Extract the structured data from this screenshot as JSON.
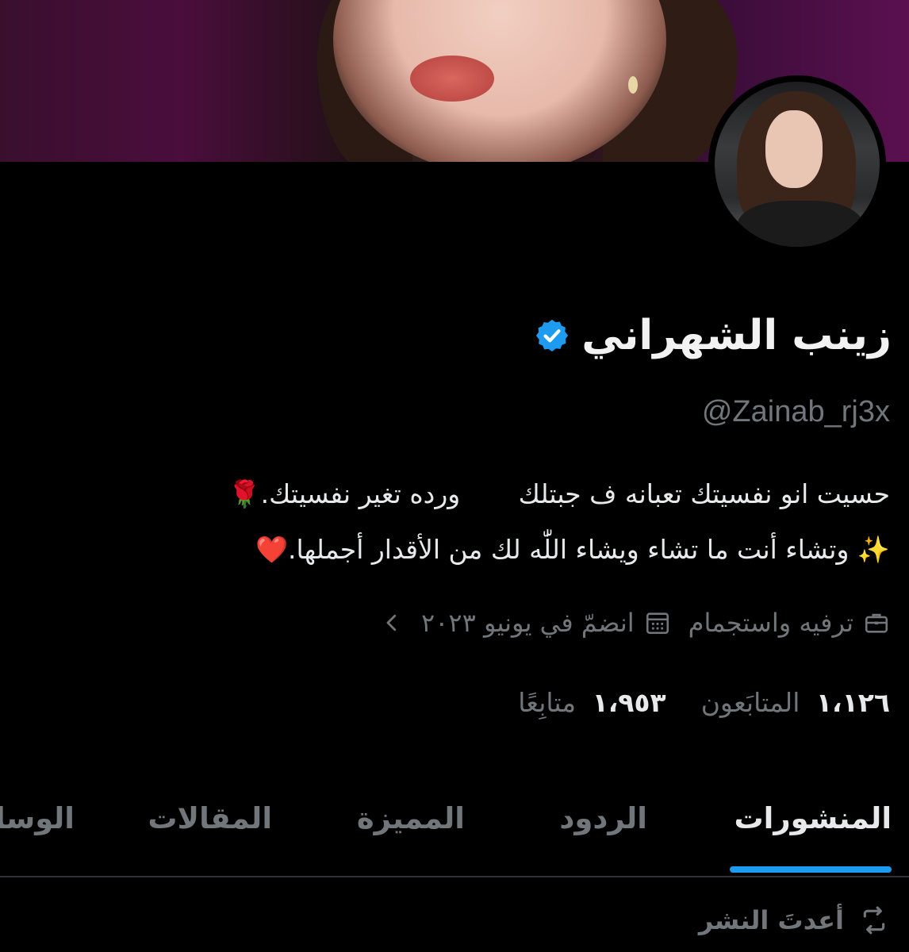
{
  "profile": {
    "display_name": "زينب الشهراني",
    "handle": "@Zainab_rj3x",
    "bio_line1": "حسيت انو نفسيتك تعبانه ف جبتلك       ورده تغير نفسيتك.🌹",
    "bio_line2": "✨ وتشاء أنت ما تشاء ويشاء اللّٰه لك من الأقدار أجملها.❤️"
  },
  "meta": {
    "category": "ترفيه واستجمام",
    "joined": "انضمّ في يونيو ٢٠٢٣"
  },
  "stats": {
    "followers_count": "١،١٢٦",
    "followers_label": "المتابَعون",
    "following_count": "١،٩٥٣",
    "following_label": "متابِعًا"
  },
  "tabs": [
    {
      "label": "المنشورات",
      "active": true
    },
    {
      "label": "الردود",
      "active": false
    },
    {
      "label": "المميزة",
      "active": false
    },
    {
      "label": "المقالات",
      "active": false
    },
    {
      "label": "الوسا",
      "active": false
    }
  ],
  "pinned": {
    "label": "أعدتَ النشر"
  },
  "colors": {
    "accent": "#1d9bf0",
    "secondary_text": "#71767b",
    "background": "#000000"
  },
  "icons": {
    "verified": "verified-badge-icon",
    "category": "briefcase-icon",
    "joined": "calendar-icon",
    "more": "chevron-left-icon",
    "repost": "repost-icon"
  }
}
